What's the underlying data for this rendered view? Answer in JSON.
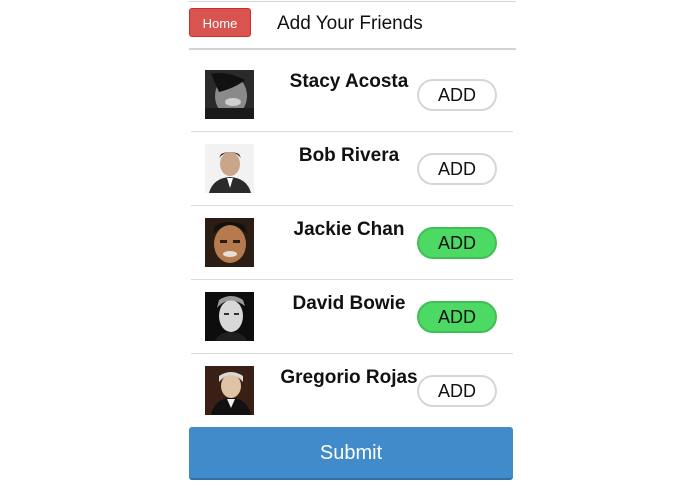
{
  "header": {
    "home_label": "Home",
    "title": "Add Your Friends"
  },
  "friends": [
    {
      "name": "Stacy Acosta",
      "add_label": "ADD",
      "added": false,
      "avatar_icon": "stacy-acosta-photo"
    },
    {
      "name": "Bob Rivera",
      "add_label": "ADD",
      "added": false,
      "avatar_icon": "bob-rivera-photo"
    },
    {
      "name": "Jackie Chan",
      "add_label": "ADD",
      "added": true,
      "avatar_icon": "jackie-chan-photo"
    },
    {
      "name": "David Bowie",
      "add_label": "ADD",
      "added": true,
      "avatar_icon": "david-bowie-photo"
    },
    {
      "name": "Gregorio Rojas",
      "add_label": "ADD",
      "added": false,
      "avatar_icon": "gregorio-rojas-photo"
    }
  ],
  "submit_label": "Submit",
  "colors": {
    "home_button": "#d9534f",
    "add_active": "#4cd964",
    "submit": "#428bca"
  }
}
